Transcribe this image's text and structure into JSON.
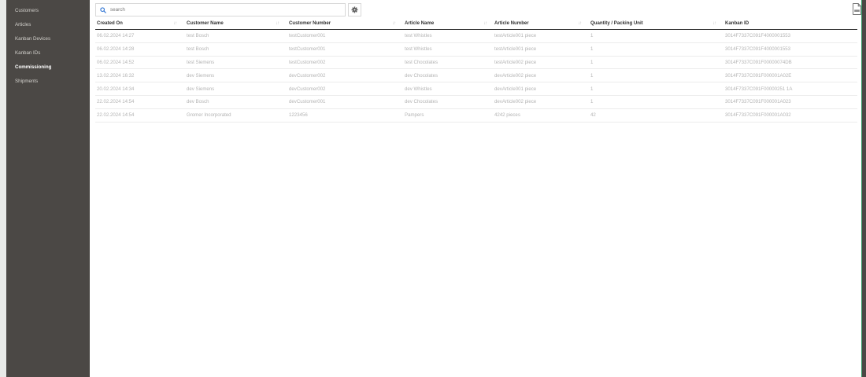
{
  "sidebar": {
    "items": [
      {
        "label": "Customers"
      },
      {
        "label": "Articles"
      },
      {
        "label": "Kanban Devices"
      },
      {
        "label": "Kanban IDs"
      },
      {
        "label": "Commissioning",
        "active": true
      },
      {
        "label": "Shipments"
      }
    ]
  },
  "toolbar": {
    "search_placeholder": "search",
    "search_value": "",
    "icons": {
      "search": "search-icon",
      "settings": "gear-icon",
      "export": "csv-file-icon"
    }
  },
  "colors": {
    "sidebar_bg": "#4b4845",
    "accent_green": "#3a9f6e",
    "search_icon": "#3a7bd5",
    "row_text": "#b4b4b4",
    "header_text": "#333333"
  },
  "table": {
    "columns": [
      {
        "label": "Created On"
      },
      {
        "label": "Customer Name"
      },
      {
        "label": "Customer Number"
      },
      {
        "label": "Article Name"
      },
      {
        "label": "Article Number"
      },
      {
        "label": "Quantity / Packing Unit"
      },
      {
        "label": "Kanban ID"
      }
    ],
    "rows": [
      [
        "06.02.2024 14:27",
        "test Bosch",
        "testCustomer001",
        "test Whistles",
        "testArticle001 piece",
        "1",
        "3014F7337C091F4000001553"
      ],
      [
        "06.02.2024 14:28",
        "test Bosch",
        "testCustomer001",
        "test Whistles",
        "testArticle001 piece",
        "1",
        "3014F7337C091F4000001553"
      ],
      [
        "06.02.2024 14:52",
        "test Siemens",
        "testCustomer002",
        "test Chocolates",
        "testArticle002 piece",
        "1",
        "3014F7337C091F00000074DB"
      ],
      [
        "13.02.2024 16:32",
        "dev Siemens",
        "devCustomer002",
        "dev Chocolates",
        "devArticle002 piece",
        "1",
        "3014F7337C091F000001A02E"
      ],
      [
        "20.02.2024 14:34",
        "dev Siemens",
        "devCustomer002",
        "dev Whistles",
        "devArticle001 piece",
        "1",
        "3014F7337C091F00000251 1A"
      ],
      [
        "22.02.2024 14:54",
        "dev Bosch",
        "devCustomer001",
        "dev Chocolates",
        "devArticle002 piece",
        "1",
        "3014F7337C091F000001A023"
      ],
      [
        "22.02.2024 14:54",
        "Gromer Incorporated",
        "1223456",
        "Pampers",
        "4242 pieces",
        "42",
        "3014F7337C091F000001A032"
      ]
    ]
  }
}
